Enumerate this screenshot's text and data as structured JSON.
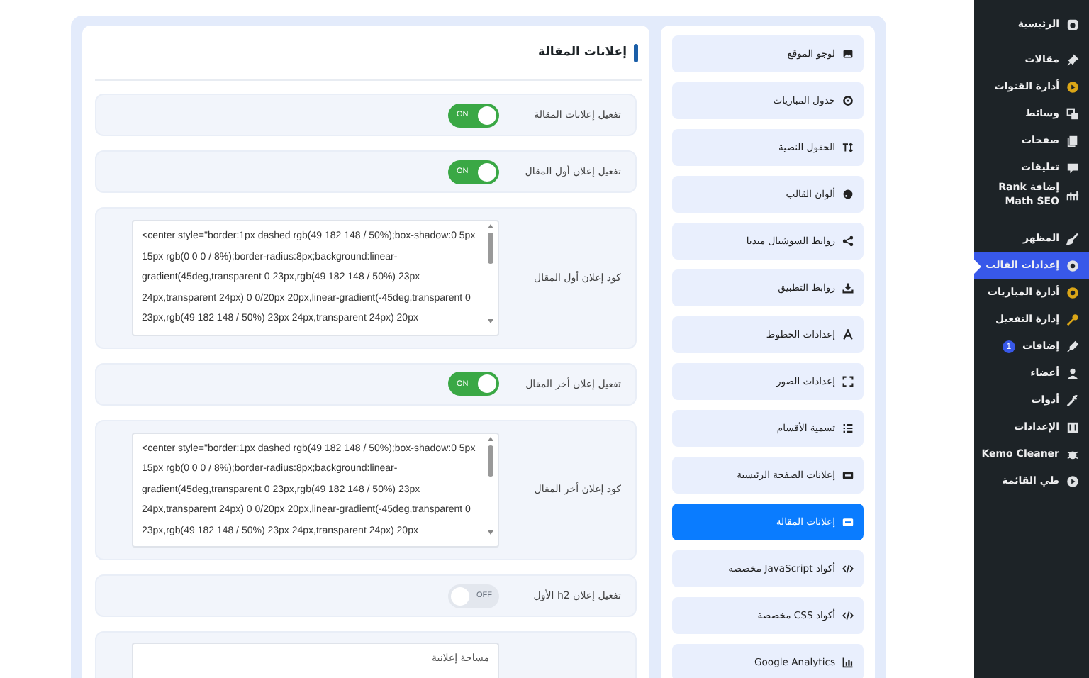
{
  "panel": {
    "title": "إعلانات المقالة",
    "rows": [
      {
        "kind": "toggle",
        "label": "تفعيل إعلانات المقالة",
        "on": true,
        "text": "ON"
      },
      {
        "kind": "toggle",
        "label": "تفعيل إعلان أول المقال",
        "on": true,
        "text": "ON"
      },
      {
        "kind": "code",
        "label": "كود إعلان أول المقال",
        "value": "<center style=\"border:1px dashed rgb(49 182 148 / 50%);box-shadow:0 5px 15px rgb(0 0 0 / 8%);border-radius:8px;background:linear-gradient(45deg,transparent 0 23px,rgb(49 182 148 / 50%) 23px 24px,transparent 24px) 0 0/20px 20px,linear-gradient(-45deg,transparent 0 23px,rgb(49 182 148 / 50%) 23px 24px,transparent 24px) 20px"
      },
      {
        "kind": "toggle",
        "label": "تفعيل إعلان أخر المقال",
        "on": true,
        "text": "ON"
      },
      {
        "kind": "code",
        "label": "كود إعلان أخر المقال",
        "value": "<center style=\"border:1px dashed rgb(49 182 148 / 50%);box-shadow:0 5px 15px rgb(0 0 0 / 8%);border-radius:8px;background:linear-gradient(45deg,transparent 0 23px,rgb(49 182 148 / 50%) 23px 24px,transparent 24px) 0 0/20px 20px,linear-gradient(-45deg,transparent 0 23px,rgb(49 182 148 / 50%) 23px 24px,transparent 24px) 20px"
      },
      {
        "kind": "toggle",
        "label": "تفعيل إعلان h2 الأول",
        "on": false,
        "text": "OFF"
      },
      {
        "kind": "area",
        "placeholder": "مساحة إعلانية"
      }
    ]
  },
  "nav": [
    {
      "label": "لوجو الموقع",
      "selected": false
    },
    {
      "label": "جدول المباريات",
      "selected": false
    },
    {
      "label": "الحقول النصية",
      "selected": false
    },
    {
      "label": "ألوان القالب",
      "selected": false
    },
    {
      "label": "روابط السوشيال ميديا",
      "selected": false
    },
    {
      "label": "روابط التطبيق",
      "selected": false
    },
    {
      "label": "إعدادات الخطوط",
      "selected": false
    },
    {
      "label": "إعدادات الصور",
      "selected": false
    },
    {
      "label": "تسمية الأقسام",
      "selected": false
    },
    {
      "label": "إعلانات الصفحة الرئيسية",
      "selected": false
    },
    {
      "label": "إعلانات المقالة",
      "selected": true
    },
    {
      "label": "أكواد JavaScript مخصصة",
      "selected": false
    },
    {
      "label": "أكواد CSS مخصصة",
      "selected": false
    },
    {
      "label": "Google Analytics",
      "selected": false
    }
  ],
  "sidebar": {
    "items": [
      {
        "label": "الرئيسية",
        "selected": false
      },
      {
        "label": "مقالات",
        "selected": false
      },
      {
        "label": "أدارة القنوات",
        "selected": false
      },
      {
        "label": "وسائط",
        "selected": false
      },
      {
        "label": "صفحات",
        "selected": false
      },
      {
        "label": "تعليقات",
        "selected": false
      },
      {
        "label": "إضافة Rank Math SEO",
        "selected": false
      },
      {
        "label": "المظهر",
        "selected": false
      },
      {
        "label": "إعدادات القالب",
        "selected": true
      },
      {
        "label": "أدارة المباريات",
        "selected": false
      },
      {
        "label": "إدارة التفعيل",
        "selected": false
      },
      {
        "label": "إضافات",
        "selected": false,
        "badge": "1"
      },
      {
        "label": "أعضاء",
        "selected": false
      },
      {
        "label": "أدوات",
        "selected": false
      },
      {
        "label": "الإعدادات",
        "selected": false
      },
      {
        "label": "Kemo Cleaner",
        "selected": false
      },
      {
        "label": "طي القائمة",
        "selected": false
      }
    ]
  }
}
